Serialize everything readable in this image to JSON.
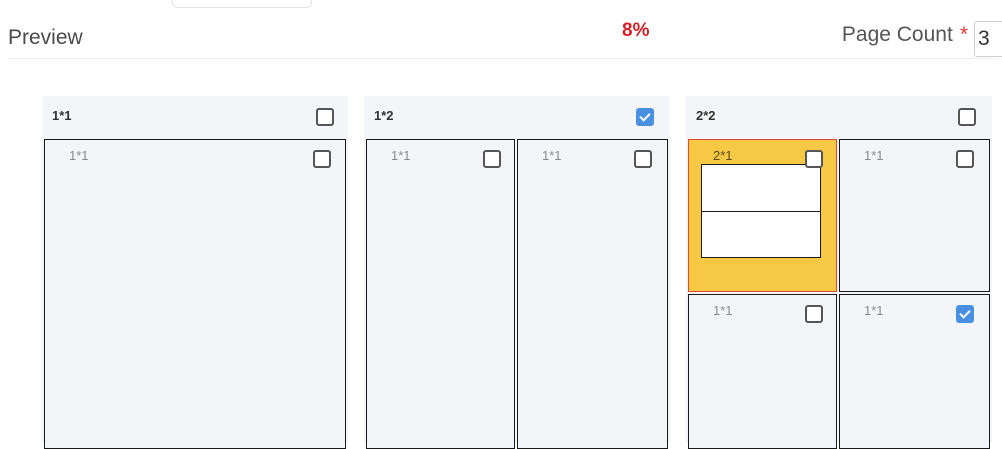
{
  "header": {
    "title": "Preview",
    "percent": "8%",
    "page_count_label": "Page Count",
    "required_mark": "*",
    "page_count_value": "3"
  },
  "colors": {
    "accent": "#4a90e2",
    "percent": "#d61f26",
    "highlight_fill": "#f7c843",
    "highlight_border": "#e04a2f"
  },
  "panels": [
    {
      "label": "1*1",
      "checked": false,
      "cells": [
        {
          "label": "1*1",
          "checked": false
        }
      ]
    },
    {
      "label": "1*2",
      "checked": true,
      "cells": [
        {
          "label": "1*1",
          "checked": false
        },
        {
          "label": "1*1",
          "checked": false
        }
      ]
    },
    {
      "label": "2*2",
      "checked": false,
      "cells": [
        {
          "label": "2*1",
          "checked": false,
          "selected": true
        },
        {
          "label": "1*1",
          "checked": false
        },
        {
          "label": "1*1",
          "checked": false
        },
        {
          "label": "1*1",
          "checked": true
        }
      ]
    }
  ]
}
